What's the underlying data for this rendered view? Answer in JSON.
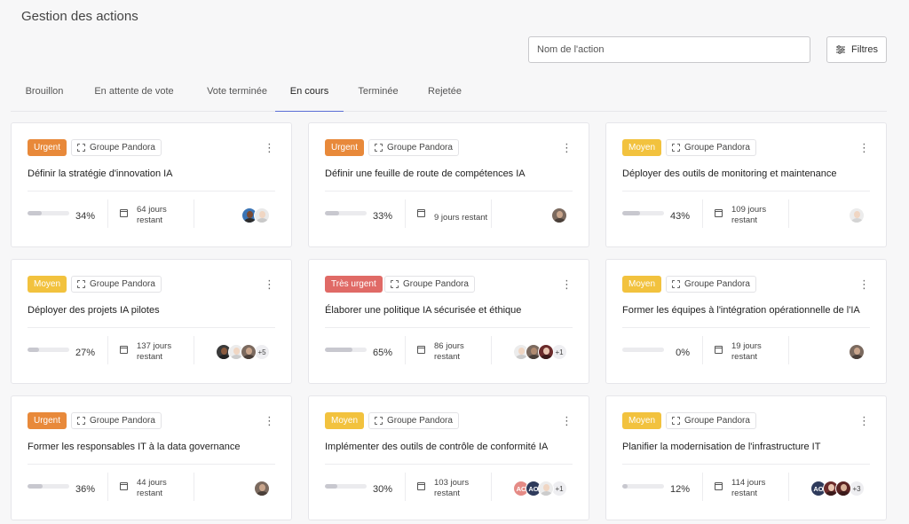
{
  "header": {
    "title": "Gestion des actions",
    "search_placeholder": "Nom de l'action",
    "filters_label": "Filtres"
  },
  "tabs": [
    {
      "label": "Brouillon",
      "active": false
    },
    {
      "label": "En attente de vote",
      "active": false
    },
    {
      "label": "Vote terminée",
      "active": false
    },
    {
      "label": "En cours",
      "active": true
    },
    {
      "label": "Terminée",
      "active": false
    },
    {
      "label": "Rejetée",
      "active": false
    }
  ],
  "colors": {
    "urgent": "#e8893a",
    "moyen": "#f2c23e",
    "tres_urgent": "#e06a66",
    "tab_active": "#5b6dd6"
  },
  "cards": [
    {
      "priority": "Urgent",
      "priority_key": "urgent",
      "group": "Groupe Pandora",
      "title": "Définir la stratégie d'innovation IA",
      "progress": 34,
      "progress_label": "34%",
      "days_line1": "64 jours",
      "days_line2": "restant",
      "avatars": [
        {
          "kind": "photo",
          "bg": "#3a74b5",
          "body": "#2c2c2c",
          "face": "#7a4a32"
        },
        {
          "kind": "photo",
          "bg": "#e9e9e9",
          "body": "#c9c9c9",
          "face": "#f0d6c3"
        }
      ],
      "more": ""
    },
    {
      "priority": "Urgent",
      "priority_key": "urgent",
      "group": "Groupe Pandora",
      "title": "Définir une feuille de route de compétences IA",
      "progress": 33,
      "progress_label": "33%",
      "days_line1": "9 jours restant",
      "days_line2": "",
      "avatars": [
        {
          "kind": "photo",
          "bg": "#7b6a5f",
          "body": "#4a3f39",
          "face": "#c9a58c"
        }
      ],
      "more": ""
    },
    {
      "priority": "Moyen",
      "priority_key": "moyen",
      "group": "Groupe Pandora",
      "title": "Déployer des outils de monitoring et maintenance",
      "progress": 43,
      "progress_label": "43%",
      "days_line1": "109 jours",
      "days_line2": "restant",
      "avatars": [
        {
          "kind": "photo",
          "bg": "#ececec",
          "body": "#d4d4d4",
          "face": "#f0d6c3"
        }
      ],
      "more": ""
    },
    {
      "priority": "Moyen",
      "priority_key": "moyen",
      "group": "Groupe Pandora",
      "title": "Déployer des projets IA pilotes",
      "progress": 27,
      "progress_label": "27%",
      "days_line1": "137 jours",
      "days_line2": "restant",
      "avatars": [
        {
          "kind": "photo",
          "bg": "#3a3a3a",
          "body": "#222",
          "face": "#8a5a3e"
        },
        {
          "kind": "photo",
          "bg": "#ececec",
          "body": "#ccc",
          "face": "#f0d6c3"
        },
        {
          "kind": "photo",
          "bg": "#7b6a5f",
          "body": "#4a3f39",
          "face": "#c9a58c"
        }
      ],
      "more": "+5"
    },
    {
      "priority": "Très urgent",
      "priority_key": "tres_urgent",
      "group": "Groupe Pandora",
      "title": "Élaborer une politique IA sécurisée et éthique",
      "progress": 65,
      "progress_label": "65%",
      "days_line1": "86 jours",
      "days_line2": "restant",
      "avatars": [
        {
          "kind": "photo",
          "bg": "#ececec",
          "body": "#ccc",
          "face": "#f0d6c3"
        },
        {
          "kind": "photo",
          "bg": "#7b6a5f",
          "body": "#4a3f39",
          "face": "#b08a70"
        },
        {
          "kind": "photo",
          "bg": "#6b2b2b",
          "body": "#3a1a1a",
          "face": "#e8c4b0"
        }
      ],
      "more": "+1"
    },
    {
      "priority": "Moyen",
      "priority_key": "moyen",
      "group": "Groupe Pandora",
      "title": "Former les équipes à l'intégration opérationnelle de l'IA",
      "progress": 0,
      "progress_label": "0%",
      "days_line1": "19 jours",
      "days_line2": "restant",
      "avatars": [
        {
          "kind": "photo",
          "bg": "#7b6a5f",
          "body": "#4a3f39",
          "face": "#c9a58c"
        }
      ],
      "more": ""
    },
    {
      "priority": "Urgent",
      "priority_key": "urgent",
      "group": "Groupe Pandora",
      "title": "Former les responsables IT à la data governance",
      "progress": 36,
      "progress_label": "36%",
      "days_line1": "44 jours",
      "days_line2": "restant",
      "avatars": [
        {
          "kind": "photo",
          "bg": "#7b6a5f",
          "body": "#4a3f39",
          "face": "#c9a58c"
        }
      ],
      "more": ""
    },
    {
      "priority": "Moyen",
      "priority_key": "moyen",
      "group": "Groupe Pandora",
      "title": "Implémenter des outils de contrôle de conformité IA",
      "progress": 30,
      "progress_label": "30%",
      "days_line1": "103 jours",
      "days_line2": "restant",
      "avatars": [
        {
          "kind": "initials",
          "text": "AC",
          "bg": "#e58b86"
        },
        {
          "kind": "initials",
          "text": "AO",
          "bg": "#2f3b5c"
        },
        {
          "kind": "photo",
          "bg": "#ececec",
          "body": "#ccc",
          "face": "#f0d6c3"
        }
      ],
      "more": "+1"
    },
    {
      "priority": "Moyen",
      "priority_key": "moyen",
      "group": "Groupe Pandora",
      "title": "Planifier la modernisation de l'infrastructure IT",
      "progress": 12,
      "progress_label": "12%",
      "days_line1": "114 jours",
      "days_line2": "restant",
      "avatars": [
        {
          "kind": "initials",
          "text": "AO",
          "bg": "#2f3b5c"
        },
        {
          "kind": "photo",
          "bg": "#6b2b2b",
          "body": "#3a1a1a",
          "face": "#e8c4b0"
        },
        {
          "kind": "photo",
          "bg": "#5a2424",
          "body": "#3a1a1a",
          "face": "#d9b29a"
        }
      ],
      "more": "+3"
    }
  ]
}
